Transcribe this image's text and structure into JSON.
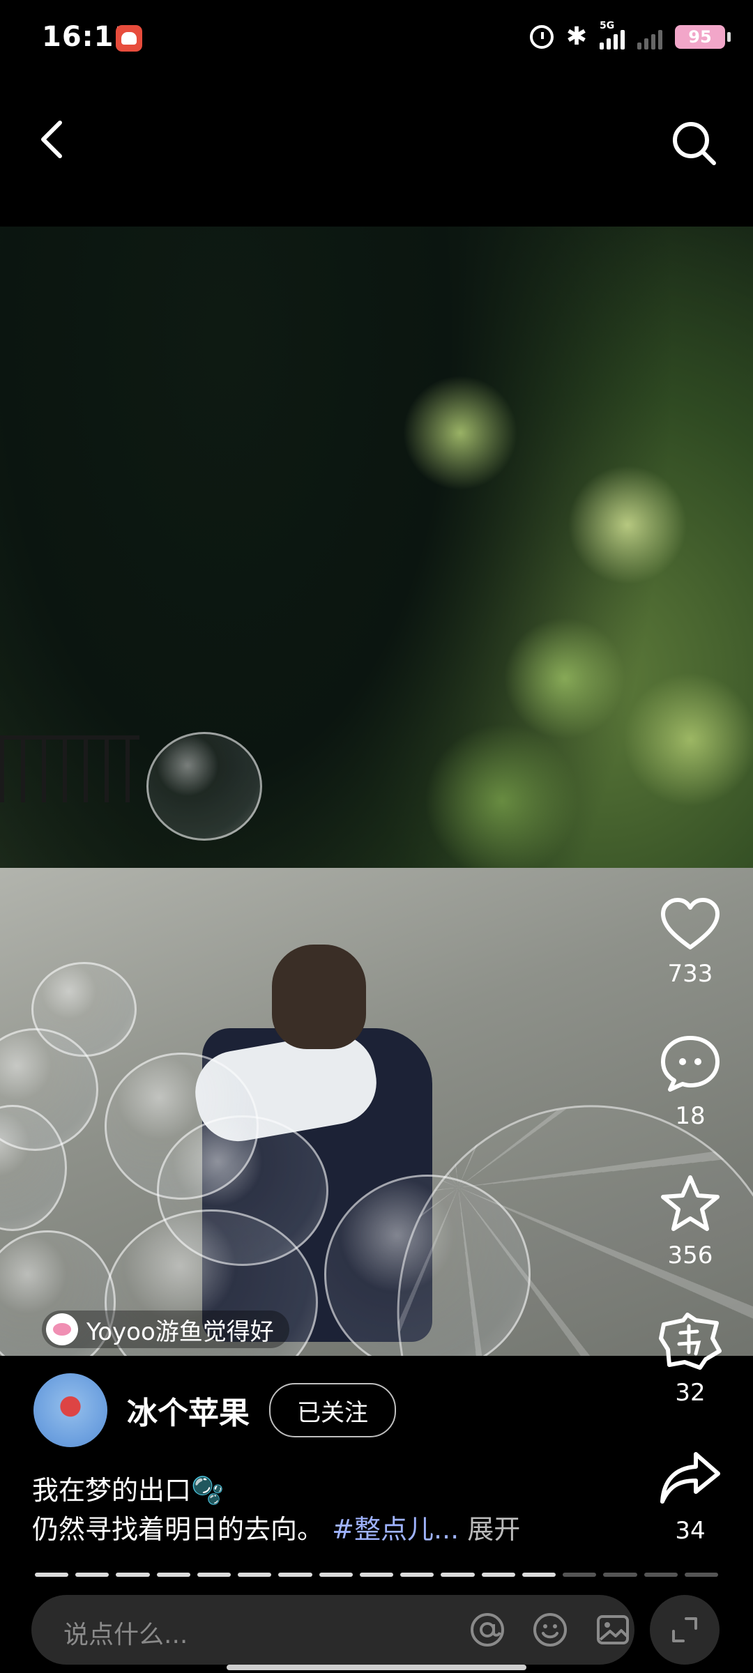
{
  "status_bar": {
    "time": "16:11",
    "network": "5G",
    "battery": "95"
  },
  "nav": {
    "back": "back-icon",
    "search": "search-icon"
  },
  "photo": {
    "liked_by": "Yoyoo游鱼觉得好"
  },
  "actions": {
    "like_count": "733",
    "comment_count": "18",
    "favorite_count": "356",
    "gift_count": "32",
    "share_count": "34"
  },
  "author": {
    "name": "冰个苹果",
    "follow_label": "已关注"
  },
  "caption": {
    "line1": "我在梦的出口🫧",
    "line2": "仍然寻找着明日的去向。",
    "tag": "#整点儿...",
    "expand": "展开"
  },
  "progress": {
    "total_segments": 17,
    "active_segments": 13
  },
  "comment_bar": {
    "placeholder": "说点什么..."
  },
  "colors": {
    "background": "#000000",
    "tag": "#9fb3ff",
    "battery": "#f2a6c9"
  }
}
